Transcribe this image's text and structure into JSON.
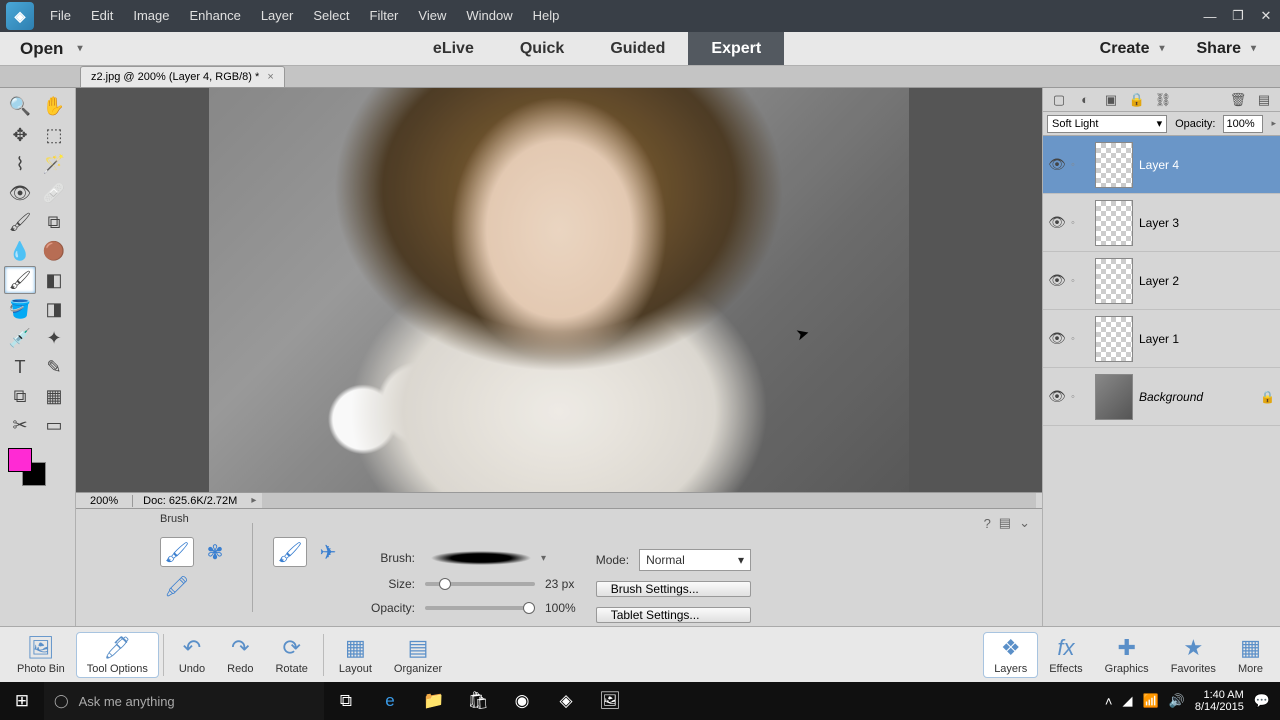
{
  "menu": [
    "File",
    "Edit",
    "Image",
    "Enhance",
    "Layer",
    "Select",
    "Filter",
    "View",
    "Window",
    "Help"
  ],
  "modebar": {
    "open": "Open",
    "tabs": [
      "eLive",
      "Quick",
      "Guided",
      "Expert"
    ],
    "active": "Expert",
    "create": "Create",
    "share": "Share"
  },
  "doctab": {
    "title": "z2.jpg @ 200% (Layer 4, RGB/8) *"
  },
  "zoom": "200%",
  "docinfo": "Doc: 625.6K/2.72M",
  "tooloptions": {
    "title": "Brush",
    "brush_label": "Brush:",
    "size_label": "Size:",
    "size_value": "23 px",
    "opacity_label": "Opacity:",
    "opacity_value": "100%",
    "mode_label": "Mode:",
    "mode_value": "Normal",
    "brush_settings": "Brush Settings...",
    "tablet_settings": "Tablet Settings..."
  },
  "layers_panel": {
    "blend_mode": "Soft Light",
    "opacity_label": "Opacity:",
    "opacity_value": "100%",
    "layers": [
      {
        "name": "Layer 4",
        "selected": true,
        "checker": true
      },
      {
        "name": "Layer 3",
        "selected": false,
        "checker": true
      },
      {
        "name": "Layer 2",
        "selected": false,
        "checker": true
      },
      {
        "name": "Layer 1",
        "selected": false,
        "checker": true
      },
      {
        "name": "Background",
        "selected": false,
        "checker": false,
        "bg": true
      }
    ]
  },
  "bottombar": {
    "left": [
      "Photo Bin",
      "Tool Options",
      "Undo",
      "Redo",
      "Rotate",
      "Layout",
      "Organizer"
    ],
    "active": "Tool Options",
    "right": [
      "Layers",
      "Effects",
      "Graphics",
      "Favorites",
      "More"
    ],
    "right_active": "Layers"
  },
  "taskbar": {
    "search_placeholder": "Ask me anything",
    "time": "1:40 AM",
    "date": "8/14/2015"
  }
}
